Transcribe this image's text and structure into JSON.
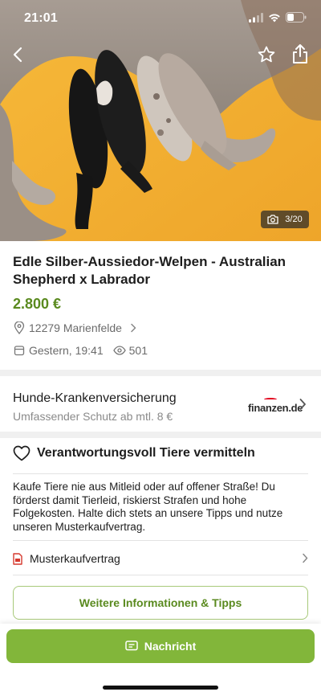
{
  "status_bar": {
    "time": "21:01"
  },
  "nav": {
    "back_icon": "chevron-left-icon",
    "favorite_icon": "star-outline-icon",
    "share_icon": "share-icon"
  },
  "gallery": {
    "counter": "3/20",
    "counter_icon": "camera-icon"
  },
  "listing": {
    "title": "Edle Silber-Aussiedor-Welpen - Australian Shepherd x Labrador",
    "price": "2.800 €",
    "location": "12279 Marienfelde",
    "date": "Gestern, 19:41",
    "views": "501"
  },
  "ad": {
    "title": "Hunde-Krankenversicherung",
    "subtitle": "Umfassender Schutz ab mtl. 8 €",
    "logo_text": "finanzen.de"
  },
  "responsibility": {
    "title": "Verantwortungsvoll Tiere vermitteln",
    "text": "Kaufe Tiere nie aus Mitleid oder auf offener Straße! Du förderst damit Tierleid, riskierst Strafen und hohe Folgekosten. Halte dich stets an unsere Tipps und nutze unseren Musterkaufvertrag.",
    "contract_label": "Musterkaufvertrag",
    "more_button": "Weitere Informationen & Tipps"
  },
  "actions": {
    "message_button": "Nachricht"
  },
  "colors": {
    "accent_green": "#82b63a",
    "price_green": "#5a8a1f",
    "pdf_red": "#d6392e"
  }
}
